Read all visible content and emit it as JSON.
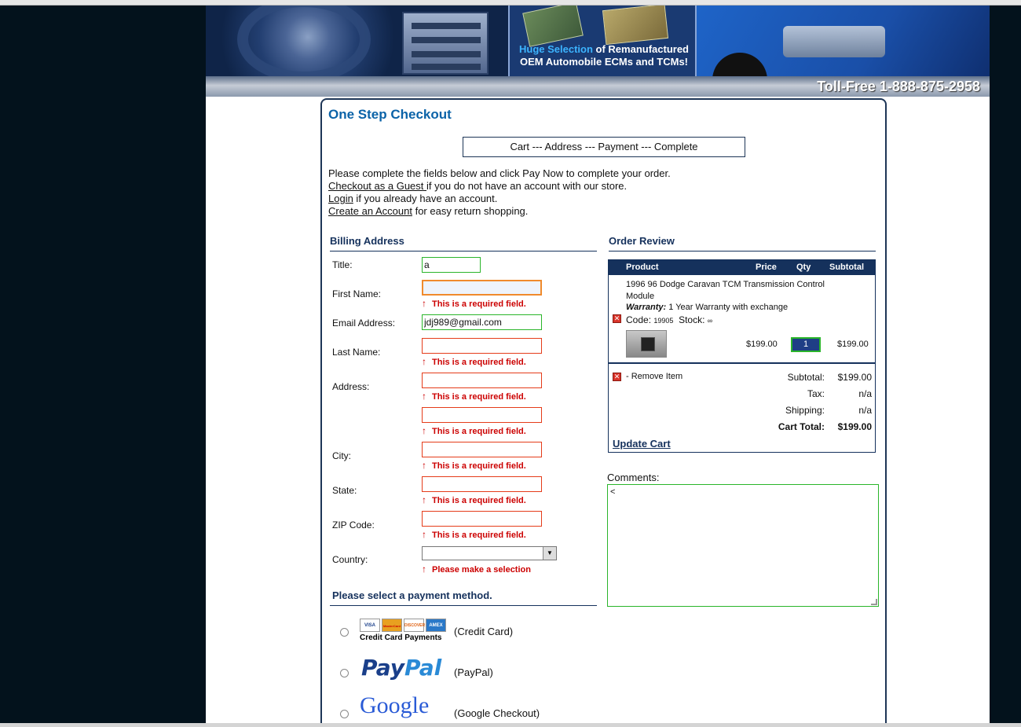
{
  "banner": {
    "ecm_highlight": "Huge Selection",
    "ecm_line1_rest": " of Remanufactured",
    "ecm_line2": "OEM Automobile ECMs and TCMs!",
    "tollfree": "Toll-Free 1-888-875-2958"
  },
  "checkout": {
    "title": "One Step Checkout",
    "steps": "Cart --- Address --- Payment --- Complete",
    "intro_line1": "Please complete the fields below and click Pay Now to complete your order.",
    "guest_link": "Checkout as a Guest ",
    "guest_rest": "if you do not have an account with our store.",
    "login_link": "Login",
    "login_rest": " if you already have an account.",
    "create_link": "Create an Account",
    "create_rest": " for easy return shopping."
  },
  "billing": {
    "heading": "Billing Address",
    "title_label": "Title:",
    "title_value": "a",
    "first_name_label": "First Name:",
    "first_name_value": "",
    "email_label": "Email Address:",
    "email_value": "jdj989@gmail.com",
    "last_name_label": "Last Name:",
    "address_label": "Address:",
    "city_label": "City:",
    "state_label": "State:",
    "zip_label": "ZIP Code:",
    "country_label": "Country:",
    "required_msg": "This is a required field.",
    "select_msg": "Please make a selection",
    "arrow": "↑"
  },
  "payment": {
    "heading": "Please select a payment method.",
    "credit_caption": "Credit Card Payments",
    "credit_label": "(Credit Card)",
    "paypal_logo_a": "Pay",
    "paypal_logo_b": "Pal",
    "paypal_label": "(PayPal)",
    "google_logo": "Google",
    "google_label": "(Google Checkout)",
    "card_visa": "VISA",
    "card_mc": "MasterCard",
    "card_disc": "DISCOVER",
    "card_amex": "AMEX"
  },
  "review": {
    "heading": "Order Review",
    "col_product": "Product",
    "col_price": "Price",
    "col_qty": "Qty",
    "col_subtotal": "Subtotal",
    "item_name_1": "1996 96 Dodge Caravan TCM Transmission Control",
    "item_name_2": "Module",
    "warranty_label": "Warranty:",
    "warranty_text": " 1 Year Warranty with exchange",
    "code_label": "Code:",
    "code_value": "19905",
    "stock_label": "Stock:",
    "stock_value": "∞",
    "price": "$199.00",
    "qty": "1",
    "line_subtotal": "$199.00",
    "remove_item": "- Remove Item",
    "subtotal_label": "Subtotal:",
    "subtotal_value": "$199.00",
    "tax_label": "Tax:",
    "tax_value": "n/a",
    "shipping_label": "Shipping:",
    "shipping_value": "n/a",
    "total_label": "Cart Total:",
    "total_value": "$199.00",
    "update_cart": "Update Cart"
  },
  "comments": {
    "label": "Comments:",
    "value": "<"
  },
  "colors": {
    "accent_blue": "#0b63a8",
    "navy": "#15315c",
    "error_red": "#cc0000",
    "valid_green": "#2ab52a"
  }
}
